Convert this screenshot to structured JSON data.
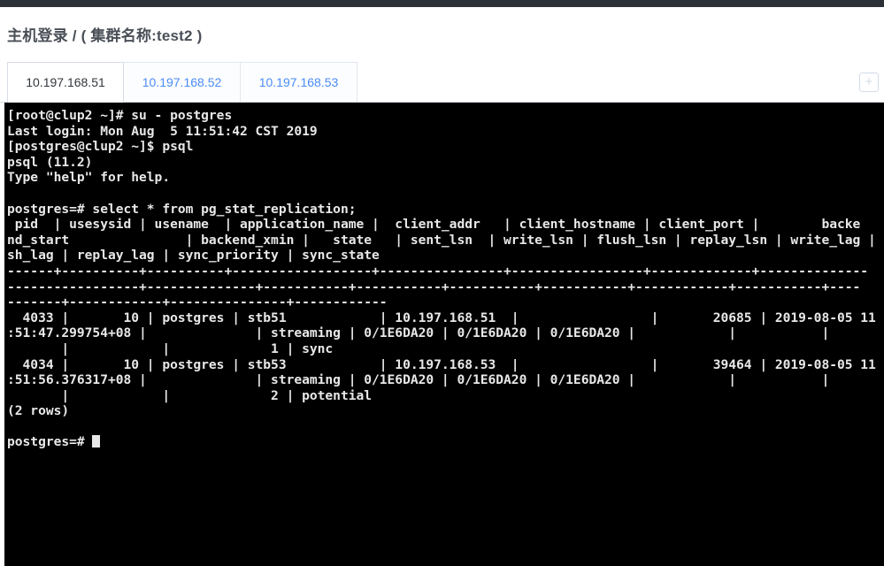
{
  "window": {
    "top_bar_color": "#2c3137",
    "background": "#ffffff"
  },
  "header": {
    "title": "主机登录 / ( 集群名称:test2 )"
  },
  "tabs": {
    "items": [
      {
        "label": "10.197.168.51",
        "active": true
      },
      {
        "label": "10.197.168.52",
        "active": false
      },
      {
        "label": "10.197.168.53",
        "active": false
      }
    ],
    "add_button_label": "+",
    "active_color": "#32363c",
    "inactive_color": "#4a8cf7"
  },
  "terminal": {
    "background": "#000000",
    "foreground": "#e8e8e8",
    "prompt": "postgres=#",
    "lines": [
      "[root@clup2 ~]# su - postgres",
      "Last login: Mon Aug  5 11:51:42 CST 2019",
      "[postgres@clup2 ~]$ psql",
      "psql (11.2)",
      "Type \"help\" for help.",
      "",
      "postgres=# select * from pg_stat_replication;",
      " pid  | usesysid | usename  | application_name |  client_addr   | client_hostname | client_port |        backe",
      "nd_start               | backend_xmin |   state   | sent_lsn  | write_lsn | flush_lsn | replay_lsn | write_lag | flu",
      "sh_lag | replay_lag | sync_priority | sync_state",
      "------+----------+----------+------------------+----------------+-----------------+-------------+--------------",
      "-----------------+--------------+-----------+-----------+-----------+-----------+------------+-----------+----",
      "-------+------------+---------------+------------",
      "  4033 |       10 | postgres | stb51            | 10.197.168.51  |                 |       20685 | 2019-08-05 11",
      ":51:47.299754+08 |              | streaming | 0/1E6DA20 | 0/1E6DA20 | 0/1E6DA20 |            |           |",
      "       |            |             1 | sync",
      "  4034 |       10 | postgres | stb53            | 10.197.168.53  |                 |       39464 | 2019-08-05 11",
      ":51:56.376317+08 |              | streaming | 0/1E6DA20 | 0/1E6DA20 | 0/1E6DA20 |            |           |",
      "       |            |             2 | potential",
      "(2 rows)",
      ""
    ],
    "prompt_line": "postgres=# "
  },
  "query": {
    "sql": "select * from pg_stat_replication;",
    "row_count_label": "(2 rows)",
    "columns": [
      "pid",
      "usesysid",
      "usename",
      "application_name",
      "client_addr",
      "client_hostname",
      "client_port",
      "backend_start",
      "backend_xmin",
      "state",
      "sent_lsn",
      "write_lsn",
      "flush_lsn",
      "replay_lsn",
      "write_lag",
      "flush_lag",
      "replay_lag",
      "sync_priority",
      "sync_state"
    ],
    "rows": [
      {
        "pid": "4033",
        "usesysid": "10",
        "usename": "postgres",
        "application_name": "stb51",
        "client_addr": "10.197.168.51",
        "client_hostname": "",
        "client_port": "20685",
        "backend_start": "2019-08-05 11:51:47.299754+08",
        "backend_xmin": "",
        "state": "streaming",
        "sent_lsn": "0/1E6DA20",
        "write_lsn": "0/1E6DA20",
        "flush_lsn": "0/1E6DA20",
        "replay_lsn": "",
        "write_lag": "",
        "flush_lag": "",
        "replay_lag": "",
        "sync_priority": "1",
        "sync_state": "sync"
      },
      {
        "pid": "4034",
        "usesysid": "10",
        "usename": "postgres",
        "application_name": "stb53",
        "client_addr": "10.197.168.53",
        "client_hostname": "",
        "client_port": "39464",
        "backend_start": "2019-08-05 11:51:56.376317+08",
        "backend_xmin": "",
        "state": "streaming",
        "sent_lsn": "0/1E6DA20",
        "write_lsn": "0/1E6DA20",
        "flush_lsn": "0/1E6DA20",
        "replay_lsn": "",
        "write_lag": "",
        "flush_lag": "",
        "replay_lag": "",
        "sync_priority": "2",
        "sync_state": "potential"
      }
    ]
  },
  "session": {
    "su_command": "su - postgres",
    "last_login": "Last login: Mon Aug  5 11:51:42 CST 2019",
    "psql_command": "psql",
    "psql_version": "psql (11.2)",
    "help_hint": "Type \"help\" for help."
  }
}
